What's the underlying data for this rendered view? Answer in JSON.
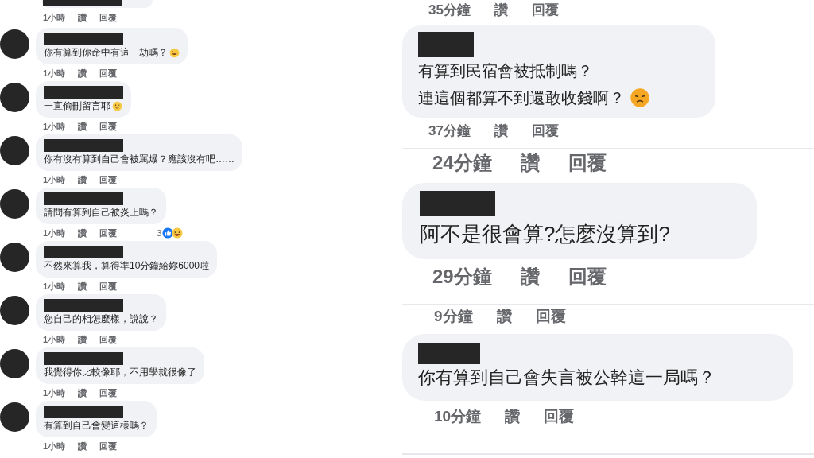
{
  "left_panel": {
    "top_meta": {
      "time": "1小時",
      "like": "讚",
      "reply": "回覆"
    },
    "comments": [
      {
        "text": "你有算到你命中有這一劫嗎？",
        "emoji": {
          "kind": "grin"
        },
        "meta": {
          "time": "1小時",
          "like": "讚",
          "reply": "回覆"
        }
      },
      {
        "text": "一直偷刪留言耶",
        "emoji": {
          "kind": "wink"
        },
        "meta": {
          "time": "1小時",
          "like": "讚",
          "reply": "回覆"
        }
      },
      {
        "text": "你有沒有算到自己會被罵爆？應該沒有吧……",
        "meta": {
          "time": "1小時",
          "like": "讚",
          "reply": "回覆"
        }
      },
      {
        "text": "請問有算到自己被炎上嗎？",
        "meta": {
          "time": "1小時",
          "like": "讚",
          "reply": "回覆"
        },
        "reactions": {
          "count": "3"
        }
      },
      {
        "text": "不然來算我，算得準10分鐘給妳6000啦",
        "meta": {
          "time": "1小時",
          "like": "讚",
          "reply": "回覆"
        }
      },
      {
        "text": "您自己的相怎麼樣，說說？",
        "meta": {
          "time": "1小時",
          "like": "讚",
          "reply": "回覆"
        }
      },
      {
        "text": "我覺得你比較像耶，不用學就很像了",
        "meta": {
          "time": "1小時",
          "like": "讚",
          "reply": "回覆"
        }
      },
      {
        "text": "有算到自己會變這樣嗎？",
        "meta": {
          "time": "1小時",
          "like": "讚",
          "reply": "回覆"
        }
      }
    ]
  },
  "right_panel": {
    "segments": [
      {
        "meta_above": {
          "time": "35分鐘",
          "like": "讚",
          "reply": "回覆"
        },
        "lines": [
          "有算到民宿會被抵制嗎？",
          "連這個都算不到還敢收錢啊？"
        ],
        "emoji": {
          "kind": "frown"
        },
        "meta": {
          "time": "37分鐘",
          "like": "讚",
          "reply": "回覆"
        }
      },
      {
        "meta_above": {
          "time": "24分鐘",
          "like": "讚",
          "reply": "回覆"
        },
        "lines": [
          "阿不是很會算?怎麼沒算到?"
        ],
        "meta": {
          "time": "29分鐘",
          "like": "讚",
          "reply": "回覆"
        }
      },
      {
        "meta_above": {
          "time": "9分鐘",
          "like": "讚",
          "reply": "回覆"
        },
        "lines": [
          "你有算到自己會失言被公幹這一局嗎？"
        ],
        "meta": {
          "time": "10分鐘",
          "like": "讚",
          "reply": "回覆"
        }
      }
    ]
  }
}
